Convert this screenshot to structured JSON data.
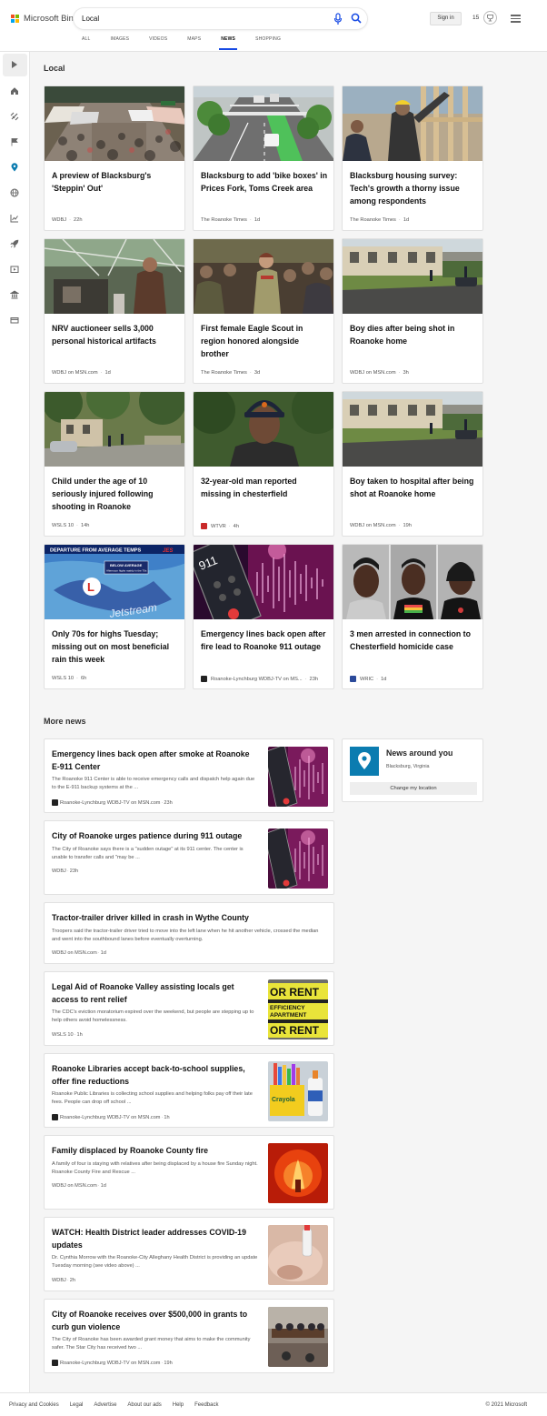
{
  "brand": {
    "name": "Microsoft Bing"
  },
  "search": {
    "query": "Local"
  },
  "header": {
    "sign_in": "Sign in",
    "rewards_count": "15"
  },
  "tabs": [
    "ALL",
    "IMAGES",
    "VIDEOS",
    "MAPS",
    "NEWS",
    "SHOPPING"
  ],
  "active_tab": "NEWS",
  "local": {
    "heading": "Local",
    "cards": [
      {
        "title": "A preview of Blacksburg's 'Steppin' Out'",
        "source": "WDBJ",
        "age": "22h"
      },
      {
        "title": "Blacksburg to add 'bike boxes' in Prices Fork, Toms Creek area",
        "source": "The Roanoke Times",
        "age": "1d"
      },
      {
        "title": "Blacksburg housing survey: Tech's growth a thorny issue among respondents",
        "source": "The Roanoke Times",
        "age": "1d"
      },
      {
        "title": "NRV auctioneer sells 3,000 personal historical artifacts",
        "source": "WDBJ on MSN.com",
        "age": "1d"
      },
      {
        "title": "First female Eagle Scout in region honored alongside brother",
        "source": "The Roanoke Times",
        "age": "3d"
      },
      {
        "title": "Boy dies after being shot in Roanoke home",
        "source": "WDBJ on MSN.com",
        "age": "3h"
      },
      {
        "title": "Child under the age of 10 seriously injured following shooting in Roanoke",
        "source": "WSLS 10",
        "age": "14h"
      },
      {
        "title": "32-year-old man reported missing in chesterfield",
        "source": "WTVR",
        "age": "4h"
      },
      {
        "title": "Boy taken to hospital after being shot at Roanoke home",
        "source": "WDBJ on MSN.com",
        "age": "19h"
      },
      {
        "title": "Only 70s for highs Tuesday; missing out on most beneficial rain this week",
        "source": "WSLS 10",
        "age": "6h"
      },
      {
        "title": "Emergency lines back open after fire lead to Roanoke 911 outage",
        "source": "Roanoke-Lynchburg WDBJ-TV on MS...",
        "age": "23h"
      },
      {
        "title": "3 men arrested in connection to Chesterfield homicide case",
        "source": "WRIC",
        "age": "1d"
      }
    ],
    "weather_banner": "DEPARTURE FROM AVERAGE TEMPS",
    "weather_sub": "BELOW AVERAGE",
    "weather_sub2": "Afternoon highs mainly in the 70s",
    "weather_brand": "JES",
    "weather_stream": "Jetstream",
    "weather_letter": "L",
    "phone_digits": "911"
  },
  "more_news": {
    "heading": "More news",
    "items": [
      {
        "title": "Emergency lines back open after smoke at Roanoke E-911 Center",
        "desc": "The Roanoke 911 Center is able to receive emergency calls and dispatch help again due to the E-911 backup systems at the ...",
        "source": "Roanoke-Lynchburg WDBJ-TV on MSN.com",
        "age": "23h"
      },
      {
        "title": "City of Roanoke urges patience during 911 outage",
        "desc": "The City of Roanoke says there is a \"sudden outage\" at its 911 center. The center is unable to transfer calls and \"may be ...",
        "source": "WDBJ",
        "age": "23h"
      },
      {
        "title": "Tractor-trailer driver killed in crash in Wythe County",
        "desc": "Troopers said the tractor-trailer driver tried to move into the left lane when he hit another vehicle, crossed the median and went into the southbound lanes before eventually overturning.",
        "source": "WDBJ on MSN.com",
        "age": "1d"
      },
      {
        "title": "Legal Aid of Roanoke Valley assisting locals get access to rent relief",
        "desc": "The CDC's eviction moratorium expired over the weekend, but people are stepping up to help others avoid homelessness.",
        "source": "WSLS 10",
        "age": "1h"
      },
      {
        "title": "Roanoke Libraries accept back-to-school supplies, offer fine reductions",
        "desc": "Roanoke Public Libraries is collecting school supplies and helping folks pay off their late fees. People can drop off school ...",
        "source": "Roanoke-Lynchburg WDBJ-TV on MSN.com",
        "age": "1h"
      },
      {
        "title": "Family displaced by Roanoke County fire",
        "desc": "A family of four is staying with relatives after being displaced by a house fire Sunday night. Roanoke County Fire and Rescue ...",
        "source": "WDBJ on MSN.com",
        "age": "1d"
      },
      {
        "title": "WATCH: Health District leader addresses COVID-19 updates",
        "desc": "Dr. Cynthia Morrow with the Roanoke-City Alleghany Health District is providing an update Tuesday morning (see video above) ...",
        "source": "WDBJ",
        "age": "2h"
      },
      {
        "title": "City of Roanoke receives over $500,000 in grants to curb gun violence",
        "desc": "The City of Roanoke has been awarded grant money that aims to make the community safer. The Star City has received two ...",
        "source": "Roanoke-Lynchburg WDBJ-TV on MSN.com",
        "age": "19h"
      }
    ],
    "rent_sign": [
      "OR RENT",
      "EFFICIENCY",
      "APARTMENT",
      "OR RENT"
    ],
    "crayons_label": "Crayola"
  },
  "news_around": {
    "title": "News around you",
    "location": "Blacksburg, Virginia",
    "button": "Change my location"
  },
  "footer": {
    "links": [
      "Privacy and Cookies",
      "Legal",
      "Advertise",
      "About our ads",
      "Help",
      "Feedback"
    ],
    "copyright": "© 2021 Microsoft"
  },
  "colors": {
    "accent": "#174ae4",
    "location_pin": "#0b7cb0"
  },
  "icons": [
    "microphone-icon",
    "search-icon",
    "rewards-icon",
    "menu-icon",
    "home-icon",
    "satellite-icon",
    "flag-icon",
    "location-icon",
    "globe-icon",
    "chart-icon",
    "rocket-icon",
    "film-icon",
    "bank-icon",
    "card-icon"
  ]
}
